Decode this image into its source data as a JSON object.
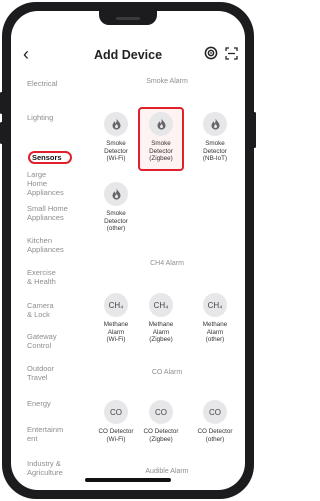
{
  "nav": {
    "back_glyph": "‹",
    "title": "Add Device"
  },
  "categories": [
    {
      "label": "Electrical"
    },
    {
      "label": "Lighting"
    },
    {
      "label": "Sensors"
    },
    {
      "label": "Large\nHome\nAppliances"
    },
    {
      "label": "Small Home\nAppliances"
    },
    {
      "label": "Kitchen\nAppliances"
    },
    {
      "label": "Exercise\n& Health"
    },
    {
      "label": "Camera\n& Lock"
    },
    {
      "label": "Gateway\nControl"
    },
    {
      "label": "Outdoor\nTravel"
    },
    {
      "label": "Energy"
    },
    {
      "label": "Entertainm\nent"
    },
    {
      "label": "Industry &\nAgriculture"
    }
  ],
  "active_category": "Sensors",
  "sections": [
    {
      "title": "Smoke Alarm"
    },
    {
      "title": "CH4 Alarm"
    },
    {
      "title": "CO Alarm"
    },
    {
      "title": "Audible Alarm"
    }
  ],
  "devices": {
    "smoke": [
      {
        "label": "Smoke\nDetector\n(Wi-Fi)",
        "icon": "flame-icon"
      },
      {
        "label": "Smoke\nDetector\n(Zigbee)",
        "icon": "flame-icon",
        "highlighted": true
      },
      {
        "label": "Smoke\nDetector\n(NB-IoT)",
        "icon": "flame-icon"
      },
      {
        "label": "Smoke\nDetector\n(other)",
        "icon": "flame-icon"
      }
    ],
    "ch4": [
      {
        "label": "Methane\nAlarm\n(Wi-Fi)",
        "glyph": "CH₄"
      },
      {
        "label": "Methane\nAlarm\n(Zigbee)",
        "glyph": "CH₄"
      },
      {
        "label": "Methane\nAlarm\n(other)",
        "glyph": "CH₄"
      }
    ],
    "co": [
      {
        "label": "CO Detector\n(Wi-Fi)",
        "glyph": "CO"
      },
      {
        "label": "CO Detector\n(Zigbee)",
        "glyph": "CO"
      },
      {
        "label": "CO Detector\n(other)",
        "glyph": "CO"
      }
    ]
  },
  "colors": {
    "highlight": "#e0202a",
    "icon_bg": "#e7e7ea",
    "muted": "#8e8e93"
  }
}
